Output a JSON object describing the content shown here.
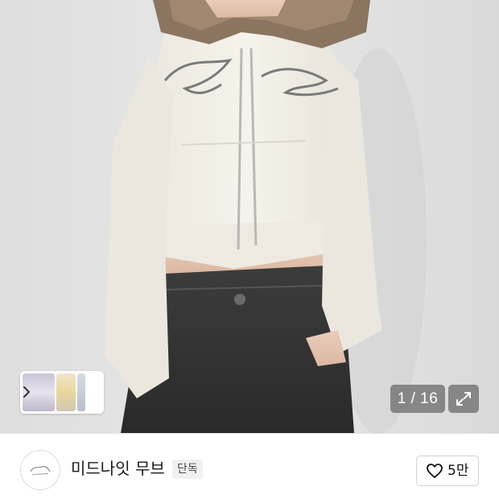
{
  "product_image": {
    "description_icon": "product-photo",
    "counter": {
      "current": "1",
      "separator": " / ",
      "total": "16",
      "text": "1 / 16"
    },
    "fullscreen_icon": "expand-arrows-icon",
    "thumbnails_icon": "chevron-right-icon"
  },
  "store": {
    "name": "미드나잇 무브",
    "badge": "단독",
    "logo_icon": "store-logo-icon"
  },
  "like": {
    "icon": "heart-outline-icon",
    "count": "5만"
  },
  "colors": {
    "background": "#ffffff",
    "counter_bg": "#6e6e6e",
    "badge_bg": "#f0f0f0",
    "text_primary": "#1a1a1a"
  }
}
